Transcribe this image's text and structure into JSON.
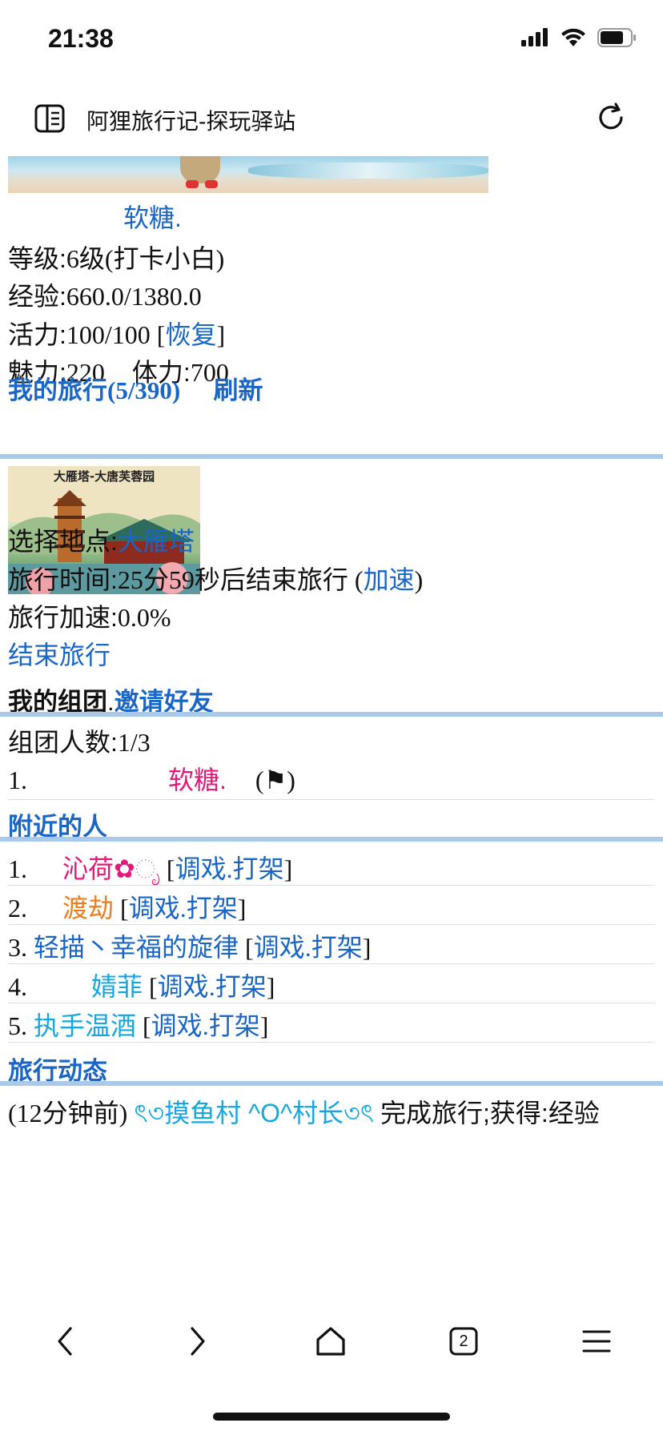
{
  "status_bar": {
    "time": "21:38"
  },
  "browser": {
    "title": "阿狸旅行记-探玩驿站"
  },
  "profile": {
    "name": "软糖.",
    "level_label": "等级:",
    "level_value": "6级(打卡小白)",
    "exp_label": "经验:",
    "exp_value": "660.0/1380.0",
    "energy_label": "活力:",
    "energy_value": "100/100 [",
    "energy_link": "恢复",
    "energy_close": "]",
    "charm_label": "魅力:",
    "charm_value": "220",
    "stamina_label": "体力:",
    "stamina_value": "700"
  },
  "my_travel": {
    "heading": "我的旅行(5/390)",
    "refresh": "刷新",
    "image_text": "大雁塔-大唐芙蓉园",
    "location_label": "选择地点:",
    "location_value": "大雁塔",
    "time_label": "旅行时间:",
    "time_value": "25分59秒后结束旅行 (",
    "speedup_link": "加速",
    "time_close": ")",
    "boost_label": "旅行加速:",
    "boost_value": "0.0%",
    "end_link": "结束旅行"
  },
  "team": {
    "heading": "我的组团",
    "dot": ".",
    "invite": "邀请好友",
    "count_label": "组团人数:",
    "count_value": "1/3",
    "member_index": "1.",
    "member_name": "软糖.",
    "member_flag": "(⚑)"
  },
  "nearby": {
    "heading": "附近的人",
    "action_flirt": "调戏",
    "action_sep": ".",
    "action_fight": "打架",
    "people": [
      {
        "index": "1.",
        "name": "沁荷✿ೃ",
        "color": "#e5197a"
      },
      {
        "index": "2.",
        "name": "渡劫",
        "color": "#f07d1a"
      },
      {
        "index": "3.",
        "name": "轻描丶幸福的旋律",
        "color": "#1a66c6"
      },
      {
        "index": "4.",
        "name": "婧菲",
        "color": "#17a6e0"
      },
      {
        "index": "5.",
        "name": "执手温酒",
        "color": "#17a6e0"
      }
    ]
  },
  "feed": {
    "heading": "旅行动态",
    "entry_time": "(12分钟前)",
    "entry_user": "ৎ৩摸鱼村 ^O^村长৩ৎ",
    "entry_text": "完成旅行;获得:经验"
  },
  "toolbar": {
    "tab_count": "2"
  }
}
